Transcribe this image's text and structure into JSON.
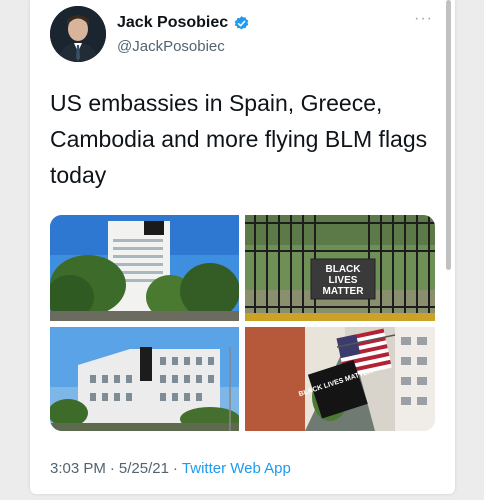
{
  "user": {
    "name": "Jack Posobiec",
    "handle": "@JackPosobiec"
  },
  "tweet": {
    "text": "US embassies in Spain, Greece, Cambodia and more flying BLM flags today",
    "time": "3:03 PM",
    "separator1": "·",
    "date": "5/25/21",
    "separator2": "·",
    "source": "Twitter Web App"
  },
  "media": {
    "sign_line1": "BLACK",
    "sign_line2": "LIVES",
    "sign_line3": "MATTER",
    "building_banner": "BLACK LIVES MATTER"
  },
  "colors": {
    "accent": "#1d9bf0",
    "text_primary": "#0f1419",
    "text_secondary": "#536471"
  },
  "icons": {
    "verified": "verified-badge-icon",
    "more": "more-options-icon"
  }
}
